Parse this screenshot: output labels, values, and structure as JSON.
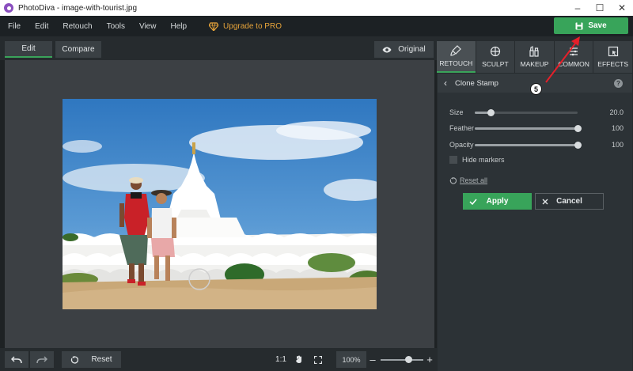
{
  "window": {
    "title": "PhotoDiva - image-with-tourist.jpg",
    "minimize": "–",
    "maximize": "☐",
    "close": "✕"
  },
  "menu": {
    "items": [
      "File",
      "Edit",
      "Retouch",
      "Tools",
      "View",
      "Help"
    ],
    "upgrade": "Upgrade to PRO"
  },
  "save_label": "Save",
  "toolbar": {
    "edit_tab": "Edit",
    "compare_tab": "Compare",
    "original_label": "Original"
  },
  "bottom": {
    "reset_label": "Reset",
    "ratio_label": "1:1",
    "zoom_value": "100%",
    "zoom_level": 0.55,
    "minus": "–",
    "plus": "+"
  },
  "right_tabs": [
    "RETOUCH",
    "SCULPT",
    "MAKEUP",
    "COMMON",
    "EFFECTS"
  ],
  "panel": {
    "title": "Clone Stamp",
    "help": "?",
    "sliders": [
      {
        "label": "Size",
        "value": "20.0",
        "level": 0.15
      },
      {
        "label": "Feather",
        "value": "100",
        "level": 1.0
      },
      {
        "label": "Opacity",
        "value": "100",
        "level": 1.0
      }
    ],
    "hide_markers": "Hide markers",
    "reset_all": "Reset all",
    "apply_label": "Apply",
    "cancel_label": "Cancel"
  },
  "annotation_number": "5",
  "colors": {
    "accent_green": "#38a45a",
    "upgrade_gold": "#e7a43a",
    "annotation_red": "#e5202a"
  }
}
